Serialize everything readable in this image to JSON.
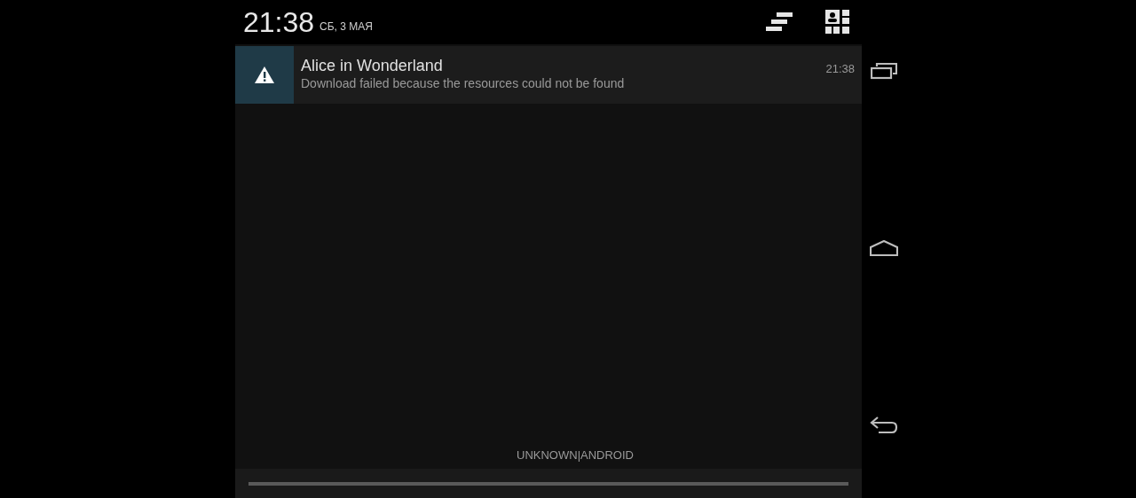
{
  "header": {
    "time": "21:38",
    "date": "СБ, 3 МАЯ"
  },
  "notifications": [
    {
      "title": "Alice in Wonderland",
      "text": "Download failed because the resources could not be found",
      "time": "21:38"
    }
  ],
  "carrier": "UNKNOWN|ANDROID"
}
